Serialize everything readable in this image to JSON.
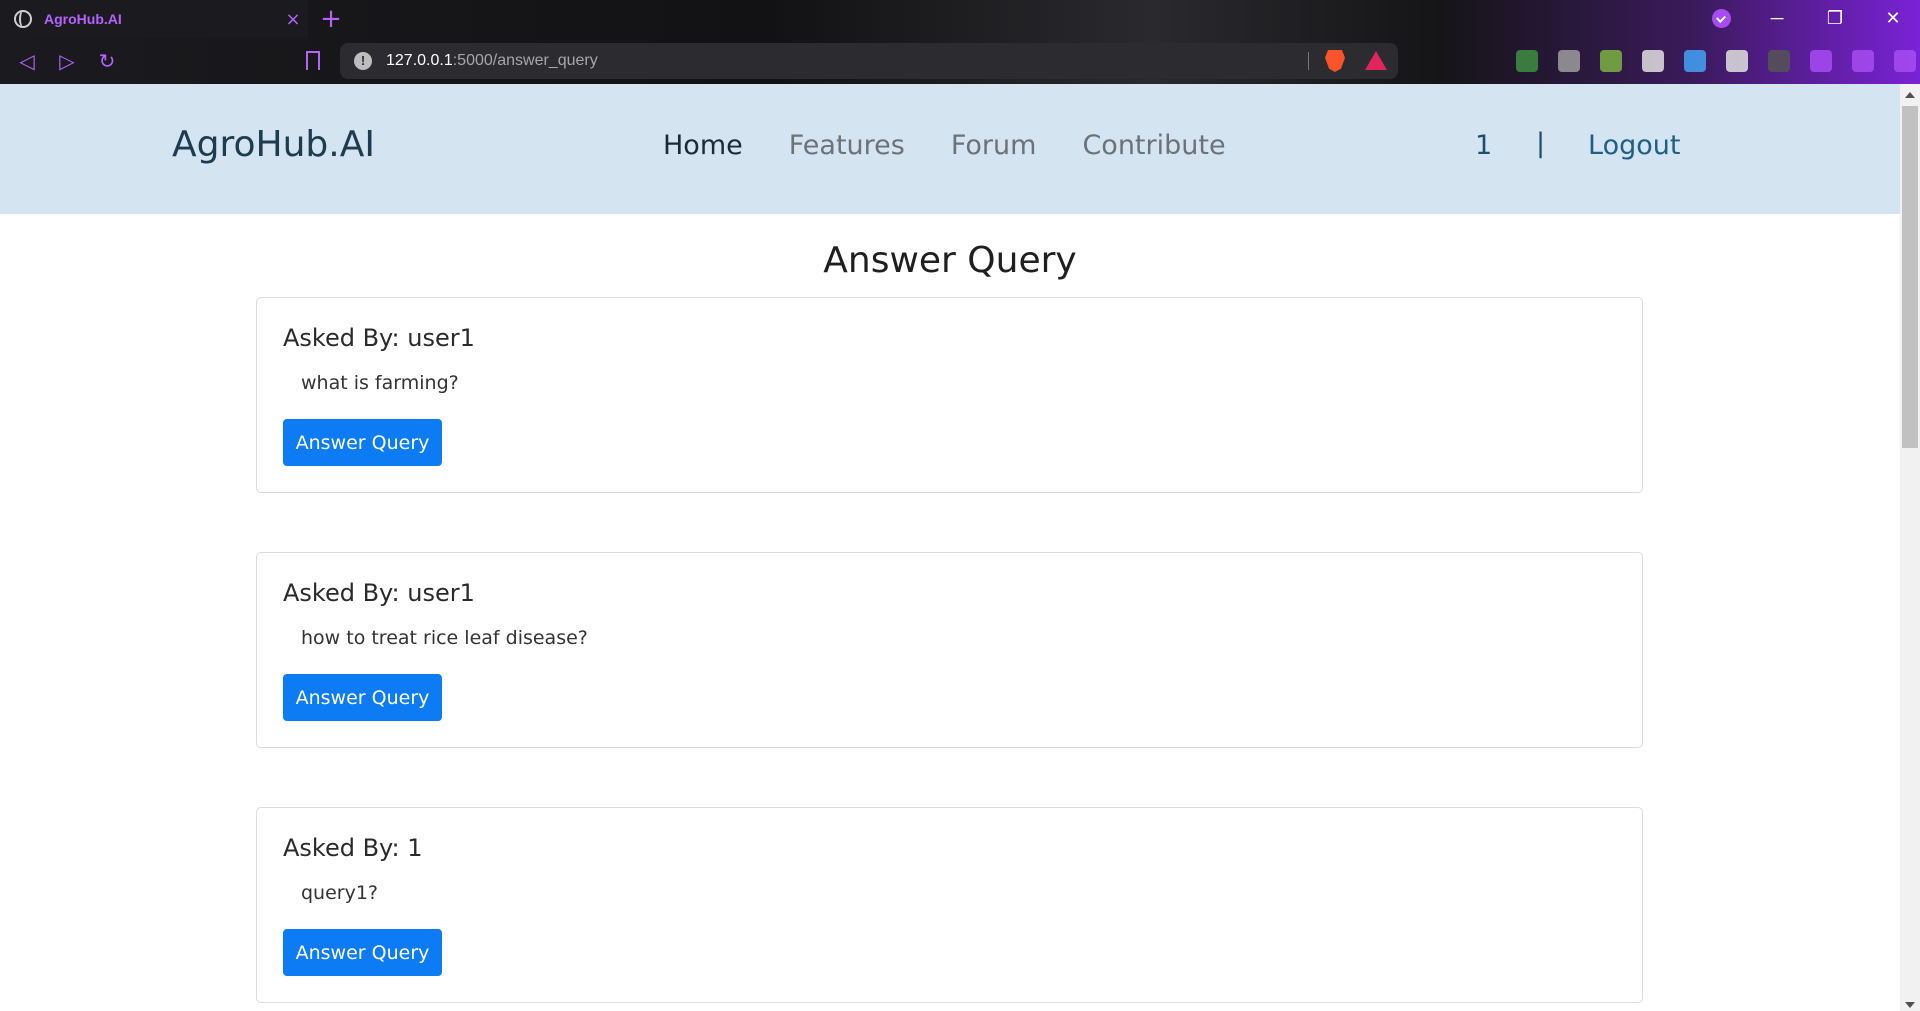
{
  "browser": {
    "tab_title": "AgroHub.AI",
    "tab_close": "×",
    "new_tab": "+",
    "url_host": "127.0.0.1",
    "url_path": ":5000/answer_query",
    "window_min": "─",
    "window_restore": "❐",
    "window_close": "✕",
    "extensions": [
      {
        "name": "dollar-extension-icon",
        "color": "#3e8e41"
      },
      {
        "name": "mouse-extension-icon",
        "color": "#9e9e9e"
      },
      {
        "name": "tree-extension-icon",
        "color": "#7cb342"
      },
      {
        "name": "timer-extension-icon",
        "color": "#e0e0e0"
      },
      {
        "name": "wave-extension-icon",
        "color": "#42a5f5"
      },
      {
        "name": "react-extension-icon",
        "color": "#e0e0e0"
      },
      {
        "name": "bracket-extension-icon",
        "color": "#555555"
      },
      {
        "name": "puzzle-extension-icon",
        "color": "#a64cf2"
      },
      {
        "name": "wallet-extension-icon",
        "color": "#a64cf2"
      },
      {
        "name": "menu-icon",
        "color": "#a64cf2"
      }
    ]
  },
  "header": {
    "brand": "AgroHub.AI",
    "nav": [
      {
        "label": "Home",
        "active": true
      },
      {
        "label": "Features",
        "active": false
      },
      {
        "label": "Forum",
        "active": false
      },
      {
        "label": "Contribute",
        "active": false
      }
    ],
    "user": "1",
    "separator": "|",
    "logout": "Logout"
  },
  "main": {
    "title": "Answer Query",
    "queries": [
      {
        "asked_by": "Asked By: user1",
        "question": "what is farming?",
        "button": "Answer Query"
      },
      {
        "asked_by": "Asked By: user1",
        "question": "how to treat rice leaf disease?",
        "button": "Answer Query"
      },
      {
        "asked_by": "Asked By: 1",
        "question": "query1?",
        "button": "Answer Query"
      }
    ]
  },
  "colors": {
    "header_bg": "#d5e4f1",
    "button_bg": "#0d7bf3",
    "accent_purple": "#b562ff"
  }
}
